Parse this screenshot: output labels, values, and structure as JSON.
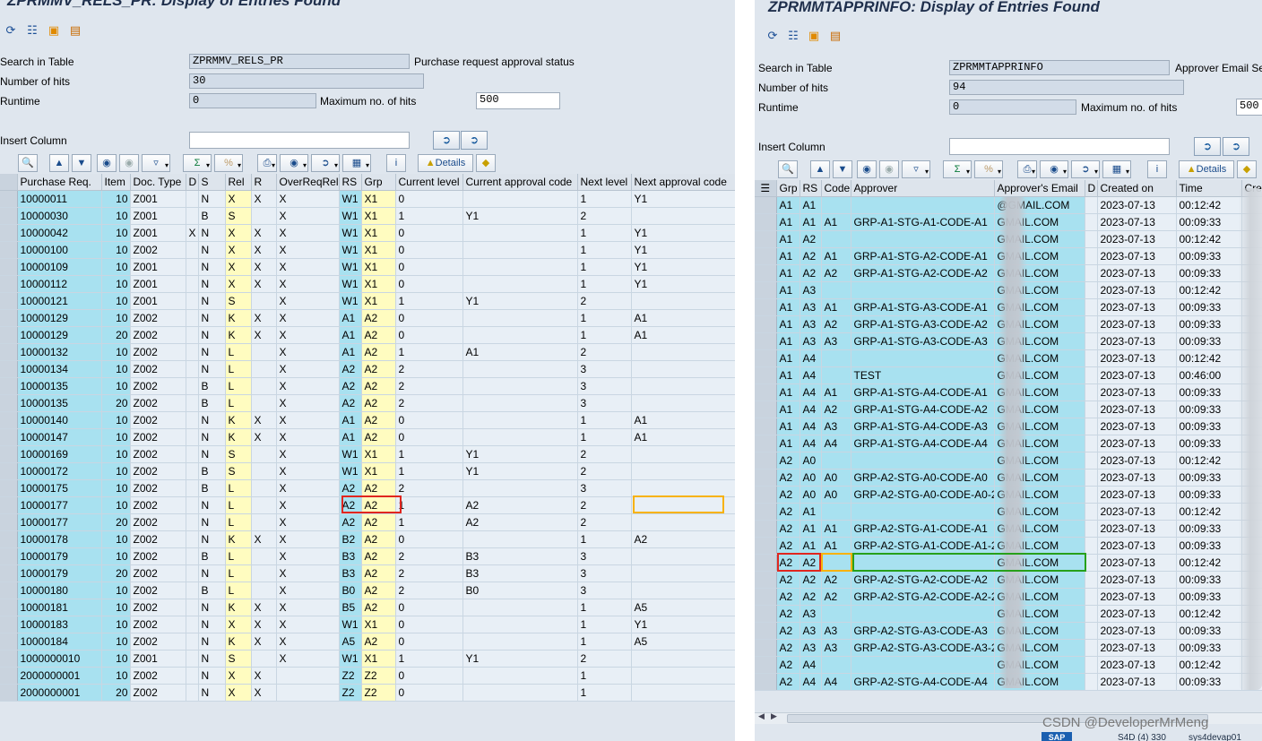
{
  "left": {
    "title": "ZPRMMV_RELS_PR: Display of Entries Found",
    "search_label": "Search in Table",
    "search_value": "ZPRMMV_RELS_PR",
    "search_desc": "Purchase request approval status",
    "hits_label": "Number of hits",
    "hits_value": "30",
    "runtime_label": "Runtime",
    "runtime_value": "0",
    "maxhits_label": "Maximum no. of hits",
    "maxhits_value": "500",
    "insert_label": "Insert Column",
    "details_label": "Details",
    "columns": [
      "Purchase Req.",
      "Item",
      "Doc. Type",
      "D",
      "S",
      "Rel",
      "R",
      "OverReqRel",
      "RS",
      "Grp",
      "Current level",
      "Current approval code",
      "Next level",
      "Next approval code"
    ],
    "rows": [
      [
        "10000011",
        "10",
        "Z001",
        "",
        "N",
        "X",
        "X",
        "X",
        "W1",
        "X1",
        "0",
        "",
        "1",
        "Y1"
      ],
      [
        "10000030",
        "10",
        "Z001",
        "",
        "B",
        "S",
        "",
        "X",
        "W1",
        "X1",
        "1",
        "Y1",
        "2",
        ""
      ],
      [
        "10000042",
        "10",
        "Z001",
        "X",
        "N",
        "X",
        "X",
        "X",
        "W1",
        "X1",
        "0",
        "",
        "1",
        "Y1"
      ],
      [
        "10000100",
        "10",
        "Z002",
        "",
        "N",
        "X",
        "X",
        "X",
        "W1",
        "X1",
        "0",
        "",
        "1",
        "Y1"
      ],
      [
        "10000109",
        "10",
        "Z001",
        "",
        "N",
        "X",
        "X",
        "X",
        "W1",
        "X1",
        "0",
        "",
        "1",
        "Y1"
      ],
      [
        "10000112",
        "10",
        "Z001",
        "",
        "N",
        "X",
        "X",
        "X",
        "W1",
        "X1",
        "0",
        "",
        "1",
        "Y1"
      ],
      [
        "10000121",
        "10",
        "Z001",
        "",
        "N",
        "S",
        "",
        "X",
        "W1",
        "X1",
        "1",
        "Y1",
        "2",
        ""
      ],
      [
        "10000129",
        "10",
        "Z002",
        "",
        "N",
        "K",
        "X",
        "X",
        "A1",
        "A2",
        "0",
        "",
        "1",
        "A1"
      ],
      [
        "10000129",
        "20",
        "Z002",
        "",
        "N",
        "K",
        "X",
        "X",
        "A1",
        "A2",
        "0",
        "",
        "1",
        "A1"
      ],
      [
        "10000132",
        "10",
        "Z002",
        "",
        "N",
        "L",
        "",
        "X",
        "A1",
        "A2",
        "1",
        "A1",
        "2",
        ""
      ],
      [
        "10000134",
        "10",
        "Z002",
        "",
        "N",
        "L",
        "",
        "X",
        "A2",
        "A2",
        "2",
        "",
        "3",
        ""
      ],
      [
        "10000135",
        "10",
        "Z002",
        "",
        "B",
        "L",
        "",
        "X",
        "A2",
        "A2",
        "2",
        "",
        "3",
        ""
      ],
      [
        "10000135",
        "20",
        "Z002",
        "",
        "B",
        "L",
        "",
        "X",
        "A2",
        "A2",
        "2",
        "",
        "3",
        ""
      ],
      [
        "10000140",
        "10",
        "Z002",
        "",
        "N",
        "K",
        "X",
        "X",
        "A1",
        "A2",
        "0",
        "",
        "1",
        "A1"
      ],
      [
        "10000147",
        "10",
        "Z002",
        "",
        "N",
        "K",
        "X",
        "X",
        "A1",
        "A2",
        "0",
        "",
        "1",
        "A1"
      ],
      [
        "10000169",
        "10",
        "Z002",
        "",
        "N",
        "S",
        "",
        "X",
        "W1",
        "X1",
        "1",
        "Y1",
        "2",
        ""
      ],
      [
        "10000172",
        "10",
        "Z002",
        "",
        "B",
        "S",
        "",
        "X",
        "W1",
        "X1",
        "1",
        "Y1",
        "2",
        ""
      ],
      [
        "10000175",
        "10",
        "Z002",
        "",
        "B",
        "L",
        "",
        "X",
        "A2",
        "A2",
        "2",
        "",
        "3",
        ""
      ],
      [
        "10000177",
        "10",
        "Z002",
        "",
        "N",
        "L",
        "",
        "X",
        "A2",
        "A2",
        "1",
        "A2",
        "2",
        ""
      ],
      [
        "10000177",
        "20",
        "Z002",
        "",
        "N",
        "L",
        "",
        "X",
        "A2",
        "A2",
        "1",
        "A2",
        "2",
        ""
      ],
      [
        "10000178",
        "10",
        "Z002",
        "",
        "N",
        "K",
        "X",
        "X",
        "B2",
        "A2",
        "0",
        "",
        "1",
        "A2"
      ],
      [
        "10000179",
        "10",
        "Z002",
        "",
        "B",
        "L",
        "",
        "X",
        "B3",
        "A2",
        "2",
        "B3",
        "3",
        ""
      ],
      [
        "10000179",
        "20",
        "Z002",
        "",
        "N",
        "L",
        "",
        "X",
        "B3",
        "A2",
        "2",
        "B3",
        "3",
        ""
      ],
      [
        "10000180",
        "10",
        "Z002",
        "",
        "B",
        "L",
        "",
        "X",
        "B0",
        "A2",
        "2",
        "B0",
        "3",
        ""
      ],
      [
        "10000181",
        "10",
        "Z002",
        "",
        "N",
        "K",
        "X",
        "X",
        "B5",
        "A2",
        "0",
        "",
        "1",
        "A5"
      ],
      [
        "10000183",
        "10",
        "Z002",
        "",
        "N",
        "X",
        "X",
        "X",
        "W1",
        "X1",
        "0",
        "",
        "1",
        "Y1"
      ],
      [
        "10000184",
        "10",
        "Z002",
        "",
        "N",
        "K",
        "X",
        "X",
        "A5",
        "A2",
        "0",
        "",
        "1",
        "A5"
      ],
      [
        "1000000010",
        "10",
        "Z001",
        "",
        "N",
        "S",
        "",
        "X",
        "W1",
        "X1",
        "1",
        "Y1",
        "2",
        ""
      ],
      [
        "2000000001",
        "10",
        "Z002",
        "",
        "N",
        "X",
        "X",
        "",
        "Z2",
        "Z2",
        "0",
        "",
        "1",
        ""
      ],
      [
        "2000000001",
        "20",
        "Z002",
        "",
        "N",
        "X",
        "X",
        "",
        "Z2",
        "Z2",
        "0",
        "",
        "1",
        ""
      ]
    ]
  },
  "right": {
    "title": "ZPRMMTAPPRINFO: Display of Entries Found",
    "search_label": "Search in Table",
    "search_value": "ZPRMMTAPPRINFO",
    "search_desc": "Approver Email Se",
    "hits_label": "Number of hits",
    "hits_value": "94",
    "runtime_label": "Runtime",
    "runtime_value": "0",
    "maxhits_label": "Maximum no. of hits",
    "maxhits_value": "500",
    "insert_label": "Insert Column",
    "details_label": "Details",
    "columns": [
      "Grp",
      "RS",
      "Code",
      "Approver",
      "Approver's Email",
      "D",
      "Created on",
      "Time",
      "Cre"
    ],
    "rows": [
      [
        "A1",
        "A1",
        "",
        "",
        "@GMAIL.COM",
        "",
        "2023-07-13",
        "00:12:42",
        ""
      ],
      [
        "A1",
        "A1",
        "A1",
        "GRP-A1-STG-A1-CODE-A1",
        "GMAIL.COM",
        "",
        "2023-07-13",
        "00:09:33",
        ""
      ],
      [
        "A1",
        "A2",
        "",
        "",
        "GMAIL.COM",
        "",
        "2023-07-13",
        "00:12:42",
        ""
      ],
      [
        "A1",
        "A2",
        "A1",
        "GRP-A1-STG-A2-CODE-A1",
        "GMAIL.COM",
        "",
        "2023-07-13",
        "00:09:33",
        ""
      ],
      [
        "A1",
        "A2",
        "A2",
        "GRP-A1-STG-A2-CODE-A2",
        "GMAIL.COM",
        "",
        "2023-07-13",
        "00:09:33",
        ""
      ],
      [
        "A1",
        "A3",
        "",
        "",
        "GMAIL.COM",
        "",
        "2023-07-13",
        "00:12:42",
        ""
      ],
      [
        "A1",
        "A3",
        "A1",
        "GRP-A1-STG-A3-CODE-A1",
        "GMAIL.COM",
        "",
        "2023-07-13",
        "00:09:33",
        ""
      ],
      [
        "A1",
        "A3",
        "A2",
        "GRP-A1-STG-A3-CODE-A2",
        "GMAIL.COM",
        "",
        "2023-07-13",
        "00:09:33",
        ""
      ],
      [
        "A1",
        "A3",
        "A3",
        "GRP-A1-STG-A3-CODE-A3",
        "GMAIL.COM",
        "",
        "2023-07-13",
        "00:09:33",
        ""
      ],
      [
        "A1",
        "A4",
        "",
        "",
        "GMAIL.COM",
        "",
        "2023-07-13",
        "00:12:42",
        ""
      ],
      [
        "A1",
        "A4",
        "",
        "TEST",
        "GMAIL.COM",
        "",
        "2023-07-13",
        "00:46:00",
        ""
      ],
      [
        "A1",
        "A4",
        "A1",
        "GRP-A1-STG-A4-CODE-A1",
        "GMAIL.COM",
        "",
        "2023-07-13",
        "00:09:33",
        ""
      ],
      [
        "A1",
        "A4",
        "A2",
        "GRP-A1-STG-A4-CODE-A2",
        "GMAIL.COM",
        "",
        "2023-07-13",
        "00:09:33",
        ""
      ],
      [
        "A1",
        "A4",
        "A3",
        "GRP-A1-STG-A4-CODE-A3",
        "GMAIL.COM",
        "",
        "2023-07-13",
        "00:09:33",
        ""
      ],
      [
        "A1",
        "A4",
        "A4",
        "GRP-A1-STG-A4-CODE-A4",
        "GMAIL.COM",
        "",
        "2023-07-13",
        "00:09:33",
        ""
      ],
      [
        "A2",
        "A0",
        "",
        "",
        "GMAIL.COM",
        "",
        "2023-07-13",
        "00:12:42",
        ""
      ],
      [
        "A2",
        "A0",
        "A0",
        "GRP-A2-STG-A0-CODE-A0",
        "GMAIL.COM",
        "",
        "2023-07-13",
        "00:09:33",
        ""
      ],
      [
        "A2",
        "A0",
        "A0",
        "GRP-A2-STG-A0-CODE-A0-2",
        "GMAIL.COM",
        "",
        "2023-07-13",
        "00:09:33",
        ""
      ],
      [
        "A2",
        "A1",
        "",
        "",
        "GMAIL.COM",
        "",
        "2023-07-13",
        "00:12:42",
        ""
      ],
      [
        "A2",
        "A1",
        "A1",
        "GRP-A2-STG-A1-CODE-A1",
        "GMAIL.COM",
        "",
        "2023-07-13",
        "00:09:33",
        ""
      ],
      [
        "A2",
        "A1",
        "A1",
        "GRP-A2-STG-A1-CODE-A1-2",
        "GMAIL.COM",
        "",
        "2023-07-13",
        "00:09:33",
        ""
      ],
      [
        "A2",
        "A2",
        "",
        "",
        "GMAIL.COM",
        "",
        "2023-07-13",
        "00:12:42",
        ""
      ],
      [
        "A2",
        "A2",
        "A2",
        "GRP-A2-STG-A2-CODE-A2",
        "GMAIL.COM",
        "",
        "2023-07-13",
        "00:09:33",
        ""
      ],
      [
        "A2",
        "A2",
        "A2",
        "GRP-A2-STG-A2-CODE-A2-2",
        "GMAIL.COM",
        "",
        "2023-07-13",
        "00:09:33",
        ""
      ],
      [
        "A2",
        "A3",
        "",
        "",
        "GMAIL.COM",
        "",
        "2023-07-13",
        "00:12:42",
        ""
      ],
      [
        "A2",
        "A3",
        "A3",
        "GRP-A2-STG-A3-CODE-A3",
        "GMAIL.COM",
        "",
        "2023-07-13",
        "00:09:33",
        ""
      ],
      [
        "A2",
        "A3",
        "A3",
        "GRP-A2-STG-A3-CODE-A3-2",
        "GMAIL.COM",
        "",
        "2023-07-13",
        "00:09:33",
        ""
      ],
      [
        "A2",
        "A4",
        "",
        "",
        "GMAIL.COM",
        "",
        "2023-07-13",
        "00:12:42",
        ""
      ],
      [
        "A2",
        "A4",
        "A4",
        "GRP-A2-STG-A4-CODE-A4",
        "GMAIL.COM",
        "",
        "2023-07-13",
        "00:09:33",
        ""
      ]
    ]
  },
  "watermark": "CSDN @DeveloperMrMeng",
  "status_text": "S4D (4) 330",
  "status_server": "sys4devap01",
  "sap_logo": "SAP",
  "colors": {
    "key_column": "#a8e1f0",
    "yellow_column": "#fffcc0",
    "highlight_red": "#e0261f",
    "highlight_orange": "#f7b20a",
    "highlight_green": "#27a01a"
  }
}
